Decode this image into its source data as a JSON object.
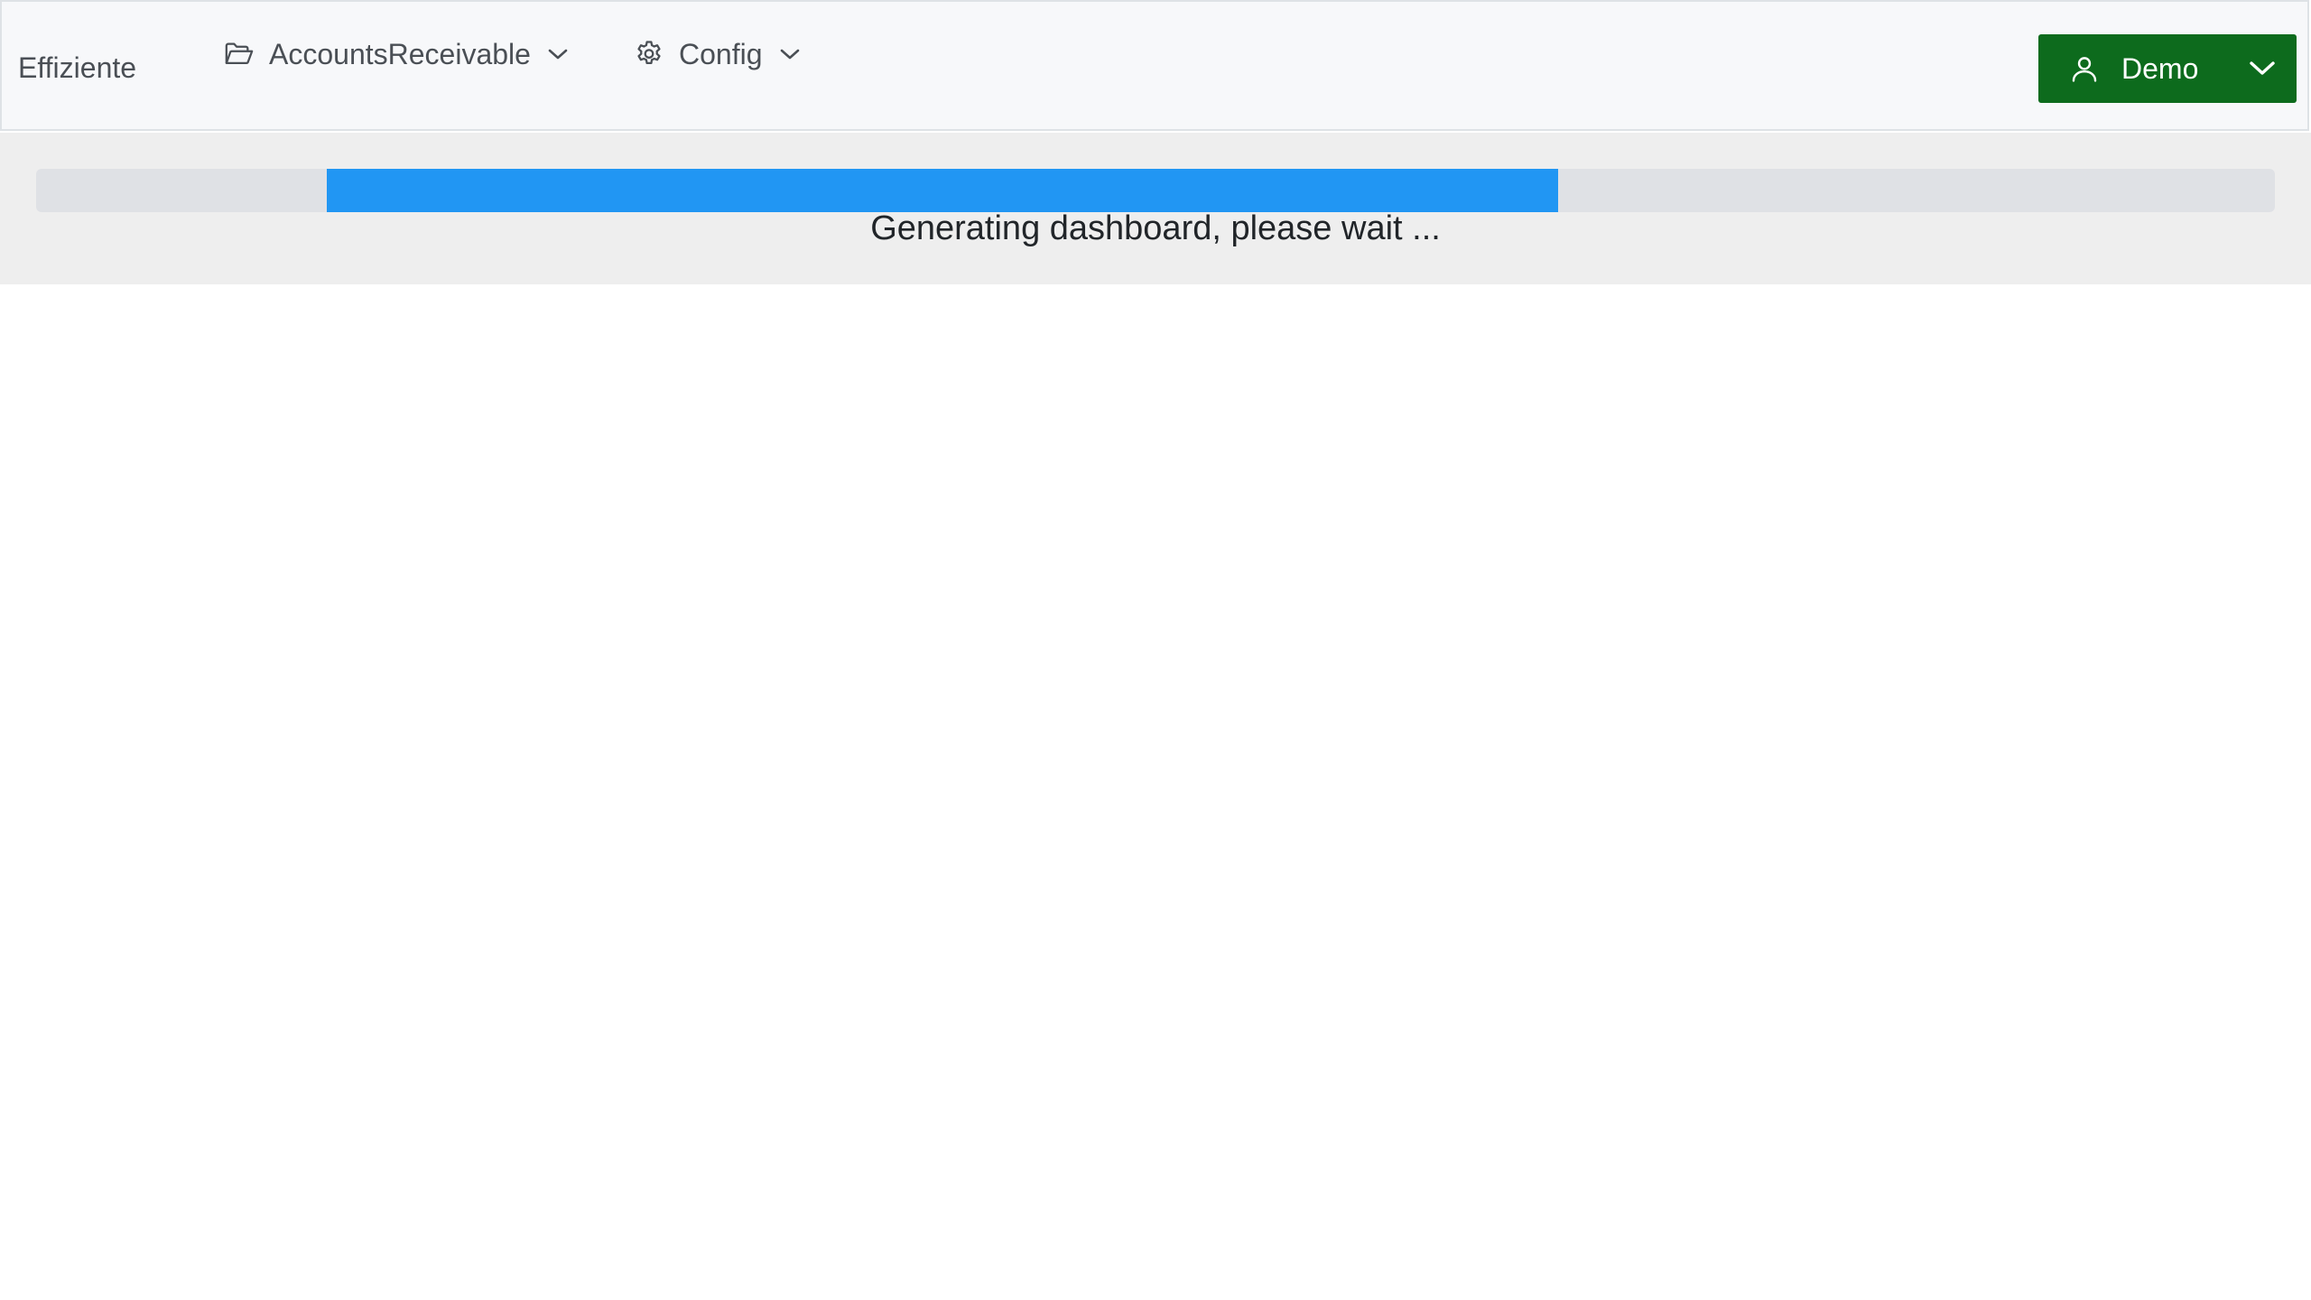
{
  "brand": "Effiziente",
  "nav": {
    "accounts": {
      "label": "AccountsReceivable",
      "icon": "folder-open-icon"
    },
    "config": {
      "label": "Config",
      "icon": "gear-icon"
    }
  },
  "user": {
    "label": "Demo",
    "icon": "user-icon"
  },
  "loading": {
    "message": "Generating dashboard, please wait ...",
    "progress_start_fraction": 0.13,
    "progress_end_fraction": 0.68
  },
  "colors": {
    "user_button": "#0d6b1d",
    "progress_bar": "#2196f3",
    "progress_track": "#dfe1e5",
    "navbar": "#f7f8fa",
    "banner": "#eeeeee"
  }
}
